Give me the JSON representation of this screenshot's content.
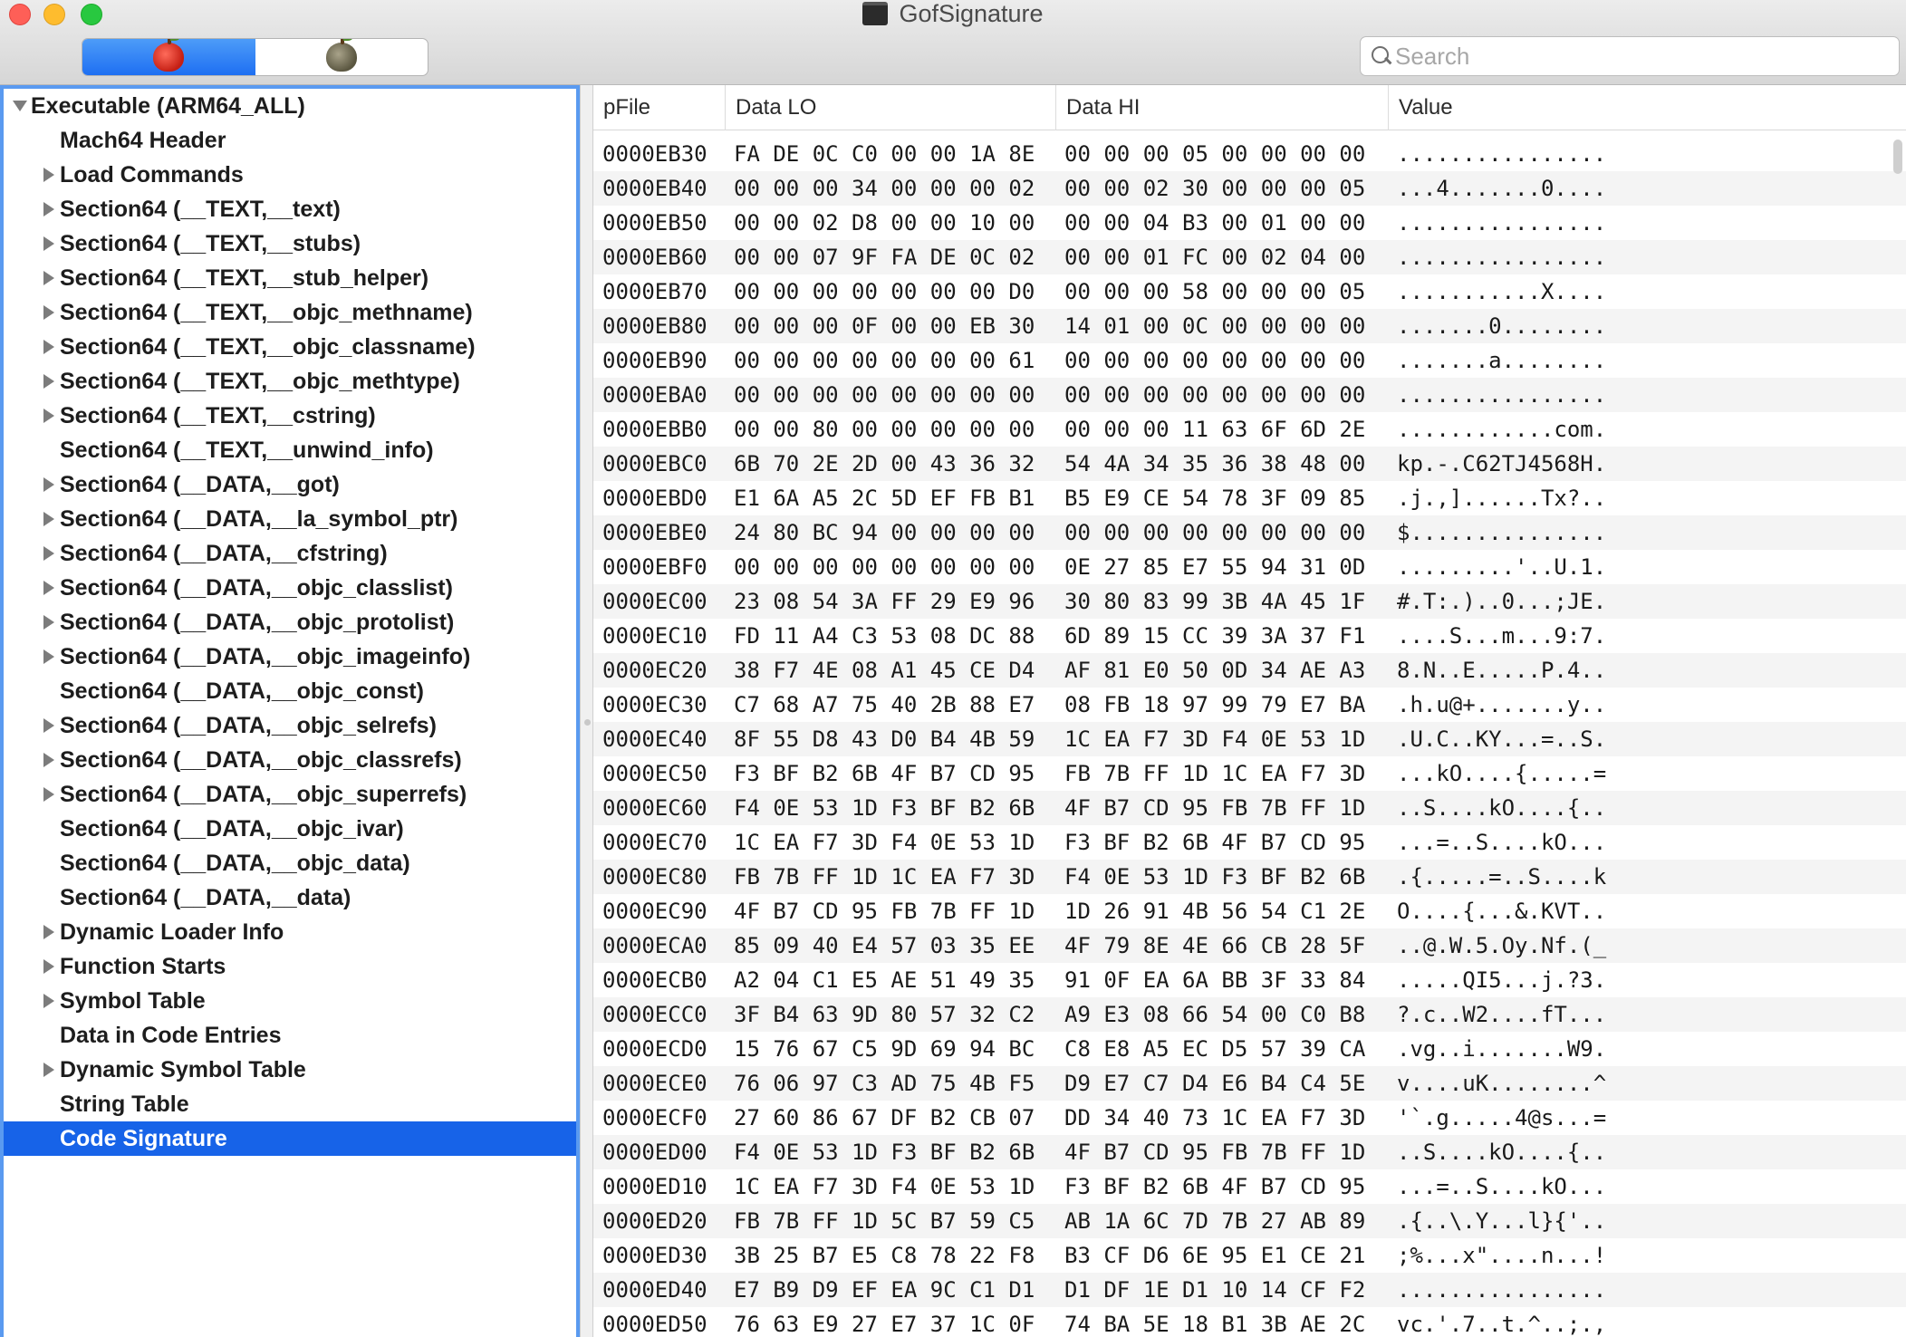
{
  "window": {
    "title": "GofSignature",
    "app_icon": "terminal-icon"
  },
  "toolbar": {
    "segments": [
      {
        "name": "red-apple-icon",
        "active": true
      },
      {
        "name": "dark-apple-icon",
        "active": false
      }
    ],
    "search": {
      "placeholder": "Search",
      "value": ""
    }
  },
  "sidebar": {
    "root": {
      "label": "Executable  (ARM64_ALL)",
      "expanded": true
    },
    "items": [
      {
        "label": "Mach64 Header",
        "expandable": false
      },
      {
        "label": "Load Commands",
        "expandable": true
      },
      {
        "label": "Section64 (__TEXT,__text)",
        "expandable": true
      },
      {
        "label": "Section64 (__TEXT,__stubs)",
        "expandable": true
      },
      {
        "label": "Section64 (__TEXT,__stub_helper)",
        "expandable": true
      },
      {
        "label": "Section64 (__TEXT,__objc_methname)",
        "expandable": true
      },
      {
        "label": "Section64 (__TEXT,__objc_classname)",
        "expandable": true
      },
      {
        "label": "Section64 (__TEXT,__objc_methtype)",
        "expandable": true
      },
      {
        "label": "Section64 (__TEXT,__cstring)",
        "expandable": true
      },
      {
        "label": "Section64 (__TEXT,__unwind_info)",
        "expandable": false
      },
      {
        "label": "Section64 (__DATA,__got)",
        "expandable": true
      },
      {
        "label": "Section64 (__DATA,__la_symbol_ptr)",
        "expandable": true
      },
      {
        "label": "Section64 (__DATA,__cfstring)",
        "expandable": true
      },
      {
        "label": "Section64 (__DATA,__objc_classlist)",
        "expandable": true
      },
      {
        "label": "Section64 (__DATA,__objc_protolist)",
        "expandable": true
      },
      {
        "label": "Section64 (__DATA,__objc_imageinfo)",
        "expandable": true
      },
      {
        "label": "Section64 (__DATA,__objc_const)",
        "expandable": false
      },
      {
        "label": "Section64 (__DATA,__objc_selrefs)",
        "expandable": true
      },
      {
        "label": "Section64 (__DATA,__objc_classrefs)",
        "expandable": true
      },
      {
        "label": "Section64 (__DATA,__objc_superrefs)",
        "expandable": true
      },
      {
        "label": "Section64 (__DATA,__objc_ivar)",
        "expandable": false
      },
      {
        "label": "Section64 (__DATA,__objc_data)",
        "expandable": false
      },
      {
        "label": "Section64 (__DATA,__data)",
        "expandable": false
      },
      {
        "label": "Dynamic Loader Info",
        "expandable": true
      },
      {
        "label": "Function Starts",
        "expandable": true
      },
      {
        "label": "Symbol Table",
        "expandable": true
      },
      {
        "label": "Data in Code Entries",
        "expandable": false
      },
      {
        "label": "Dynamic Symbol Table",
        "expandable": true
      },
      {
        "label": "String Table",
        "expandable": false
      },
      {
        "label": "Code Signature",
        "expandable": false,
        "selected": true
      }
    ]
  },
  "table": {
    "columns": [
      "pFile",
      "Data LO",
      "Data HI",
      "Value"
    ],
    "rows": [
      {
        "pfile": "0000EB30",
        "lo": "FA DE 0C C0 00 00 1A 8E",
        "hi": "00 00 00 05 00 00 00 00",
        "value": "................"
      },
      {
        "pfile": "0000EB40",
        "lo": "00 00 00 34 00 00 00 02",
        "hi": "00 00 02 30 00 00 00 05",
        "value": "...4.......0...."
      },
      {
        "pfile": "0000EB50",
        "lo": "00 00 02 D8 00 00 10 00",
        "hi": "00 00 04 B3 00 01 00 00",
        "value": "................"
      },
      {
        "pfile": "0000EB60",
        "lo": "00 00 07 9F FA DE 0C 02",
        "hi": "00 00 01 FC 00 02 04 00",
        "value": "................"
      },
      {
        "pfile": "0000EB70",
        "lo": "00 00 00 00 00 00 00 D0",
        "hi": "00 00 00 58 00 00 00 05",
        "value": "...........X...."
      },
      {
        "pfile": "0000EB80",
        "lo": "00 00 00 0F 00 00 EB 30",
        "hi": "14 01 00 0C 00 00 00 00",
        "value": ".......0........"
      },
      {
        "pfile": "0000EB90",
        "lo": "00 00 00 00 00 00 00 61",
        "hi": "00 00 00 00 00 00 00 00",
        "value": ".......a........"
      },
      {
        "pfile": "0000EBA0",
        "lo": "00 00 00 00 00 00 00 00",
        "hi": "00 00 00 00 00 00 00 00",
        "value": "................"
      },
      {
        "pfile": "0000EBB0",
        "lo": "00 00 80 00 00 00 00 00",
        "hi": "00 00 00 11 63 6F 6D 2E",
        "value": "............com."
      },
      {
        "pfile": "0000EBC0",
        "lo": "6B 70 2E 2D 00 43 36 32",
        "hi": "54 4A 34 35 36 38 48 00",
        "value": "kp.-.C62TJ4568H."
      },
      {
        "pfile": "0000EBD0",
        "lo": "E1 6A A5 2C 5D EF FB B1",
        "hi": "B5 E9 CE 54 78 3F 09 85",
        "value": ".j.,]......Tx?.."
      },
      {
        "pfile": "0000EBE0",
        "lo": "24 80 BC 94 00 00 00 00",
        "hi": "00 00 00 00 00 00 00 00",
        "value": "$..............."
      },
      {
        "pfile": "0000EBF0",
        "lo": "00 00 00 00 00 00 00 00",
        "hi": "0E 27 85 E7 55 94 31 0D",
        "value": ".........'..U.1."
      },
      {
        "pfile": "0000EC00",
        "lo": "23 08 54 3A FF 29 E9 96",
        "hi": "30 80 83 99 3B 4A 45 1F",
        "value": "#.T:.)..0...;JE."
      },
      {
        "pfile": "0000EC10",
        "lo": "FD 11 A4 C3 53 08 DC 88",
        "hi": "6D 89 15 CC 39 3A 37 F1",
        "value": "....S...m...9:7."
      },
      {
        "pfile": "0000EC20",
        "lo": "38 F7 4E 08 A1 45 CE D4",
        "hi": "AF 81 E0 50 0D 34 AE A3",
        "value": "8.N..E.....P.4.."
      },
      {
        "pfile": "0000EC30",
        "lo": "C7 68 A7 75 40 2B 88 E7",
        "hi": "08 FB 18 97 99 79 E7 BA",
        "value": ".h.u@+.......y.."
      },
      {
        "pfile": "0000EC40",
        "lo": "8F 55 D8 43 D0 B4 4B 59",
        "hi": "1C EA F7 3D F4 0E 53 1D",
        "value": ".U.C..KY...=..S."
      },
      {
        "pfile": "0000EC50",
        "lo": "F3 BF B2 6B 4F B7 CD 95",
        "hi": "FB 7B FF 1D 1C EA F7 3D",
        "value": "...kO....{.....="
      },
      {
        "pfile": "0000EC60",
        "lo": "F4 0E 53 1D F3 BF B2 6B",
        "hi": "4F B7 CD 95 FB 7B FF 1D",
        "value": "..S....kO....{.."
      },
      {
        "pfile": "0000EC70",
        "lo": "1C EA F7 3D F4 0E 53 1D",
        "hi": "F3 BF B2 6B 4F B7 CD 95",
        "value": "...=..S....kO..."
      },
      {
        "pfile": "0000EC80",
        "lo": "FB 7B FF 1D 1C EA F7 3D",
        "hi": "F4 0E 53 1D F3 BF B2 6B",
        "value": ".{.....=..S....k"
      },
      {
        "pfile": "0000EC90",
        "lo": "4F B7 CD 95 FB 7B FF 1D",
        "hi": "1D 26 91 4B 56 54 C1 2E",
        "value": "O....{...&.KVT.."
      },
      {
        "pfile": "0000ECA0",
        "lo": "85 09 40 E4 57 03 35 EE",
        "hi": "4F 79 8E 4E 66 CB 28 5F",
        "value": "..@.W.5.Oy.Nf.(_"
      },
      {
        "pfile": "0000ECB0",
        "lo": "A2 04 C1 E5 AE 51 49 35",
        "hi": "91 0F EA 6A BB 3F 33 84",
        "value": ".....QI5...j.?3."
      },
      {
        "pfile": "0000ECC0",
        "lo": "3F B4 63 9D 80 57 32 C2",
        "hi": "A9 E3 08 66 54 00 C0 B8",
        "value": "?.c..W2....fT..."
      },
      {
        "pfile": "0000ECD0",
        "lo": "15 76 67 C5 9D 69 94 BC",
        "hi": "C8 E8 A5 EC D5 57 39 CA",
        "value": ".vg..i.......W9."
      },
      {
        "pfile": "0000ECE0",
        "lo": "76 06 97 C3 AD 75 4B F5",
        "hi": "D9 E7 C7 D4 E6 B4 C4 5E",
        "value": "v....uK........^"
      },
      {
        "pfile": "0000ECF0",
        "lo": "27 60 86 67 DF B2 CB 07",
        "hi": "DD 34 40 73 1C EA F7 3D",
        "value": "'`.g.....4@s...="
      },
      {
        "pfile": "0000ED00",
        "lo": "F4 0E 53 1D F3 BF B2 6B",
        "hi": "4F B7 CD 95 FB 7B FF 1D",
        "value": "..S....kO....{.."
      },
      {
        "pfile": "0000ED10",
        "lo": "1C EA F7 3D F4 0E 53 1D",
        "hi": "F3 BF B2 6B 4F B7 CD 95",
        "value": "...=..S....kO..."
      },
      {
        "pfile": "0000ED20",
        "lo": "FB 7B FF 1D 5C B7 59 C5",
        "hi": "AB 1A 6C 7D 7B 27 AB 89",
        "value": ".{..\\.Y...l}{'.."
      },
      {
        "pfile": "0000ED30",
        "lo": "3B 25 B7 E5 C8 78 22 F8",
        "hi": "B3 CF D6 6E 95 E1 CE 21",
        "value": ";%...x\"....n...!"
      },
      {
        "pfile": "0000ED40",
        "lo": "E7 B9 D9 EF EA 9C C1 D1",
        "hi": "D1 DF 1E D1 10 14 CF F2",
        "value": "................"
      },
      {
        "pfile": "0000ED50",
        "lo": "76 63 E9 27 E7 37 1C 0F",
        "hi": "74 BA 5E 18 B1 3B AE 2C",
        "value": "vc.'.7..t.^..;.,"
      }
    ]
  },
  "colors": {
    "selection": "#1763e8",
    "sidebar_focus_border": "#5a9af0",
    "row_alt": "#f4f4f4"
  }
}
